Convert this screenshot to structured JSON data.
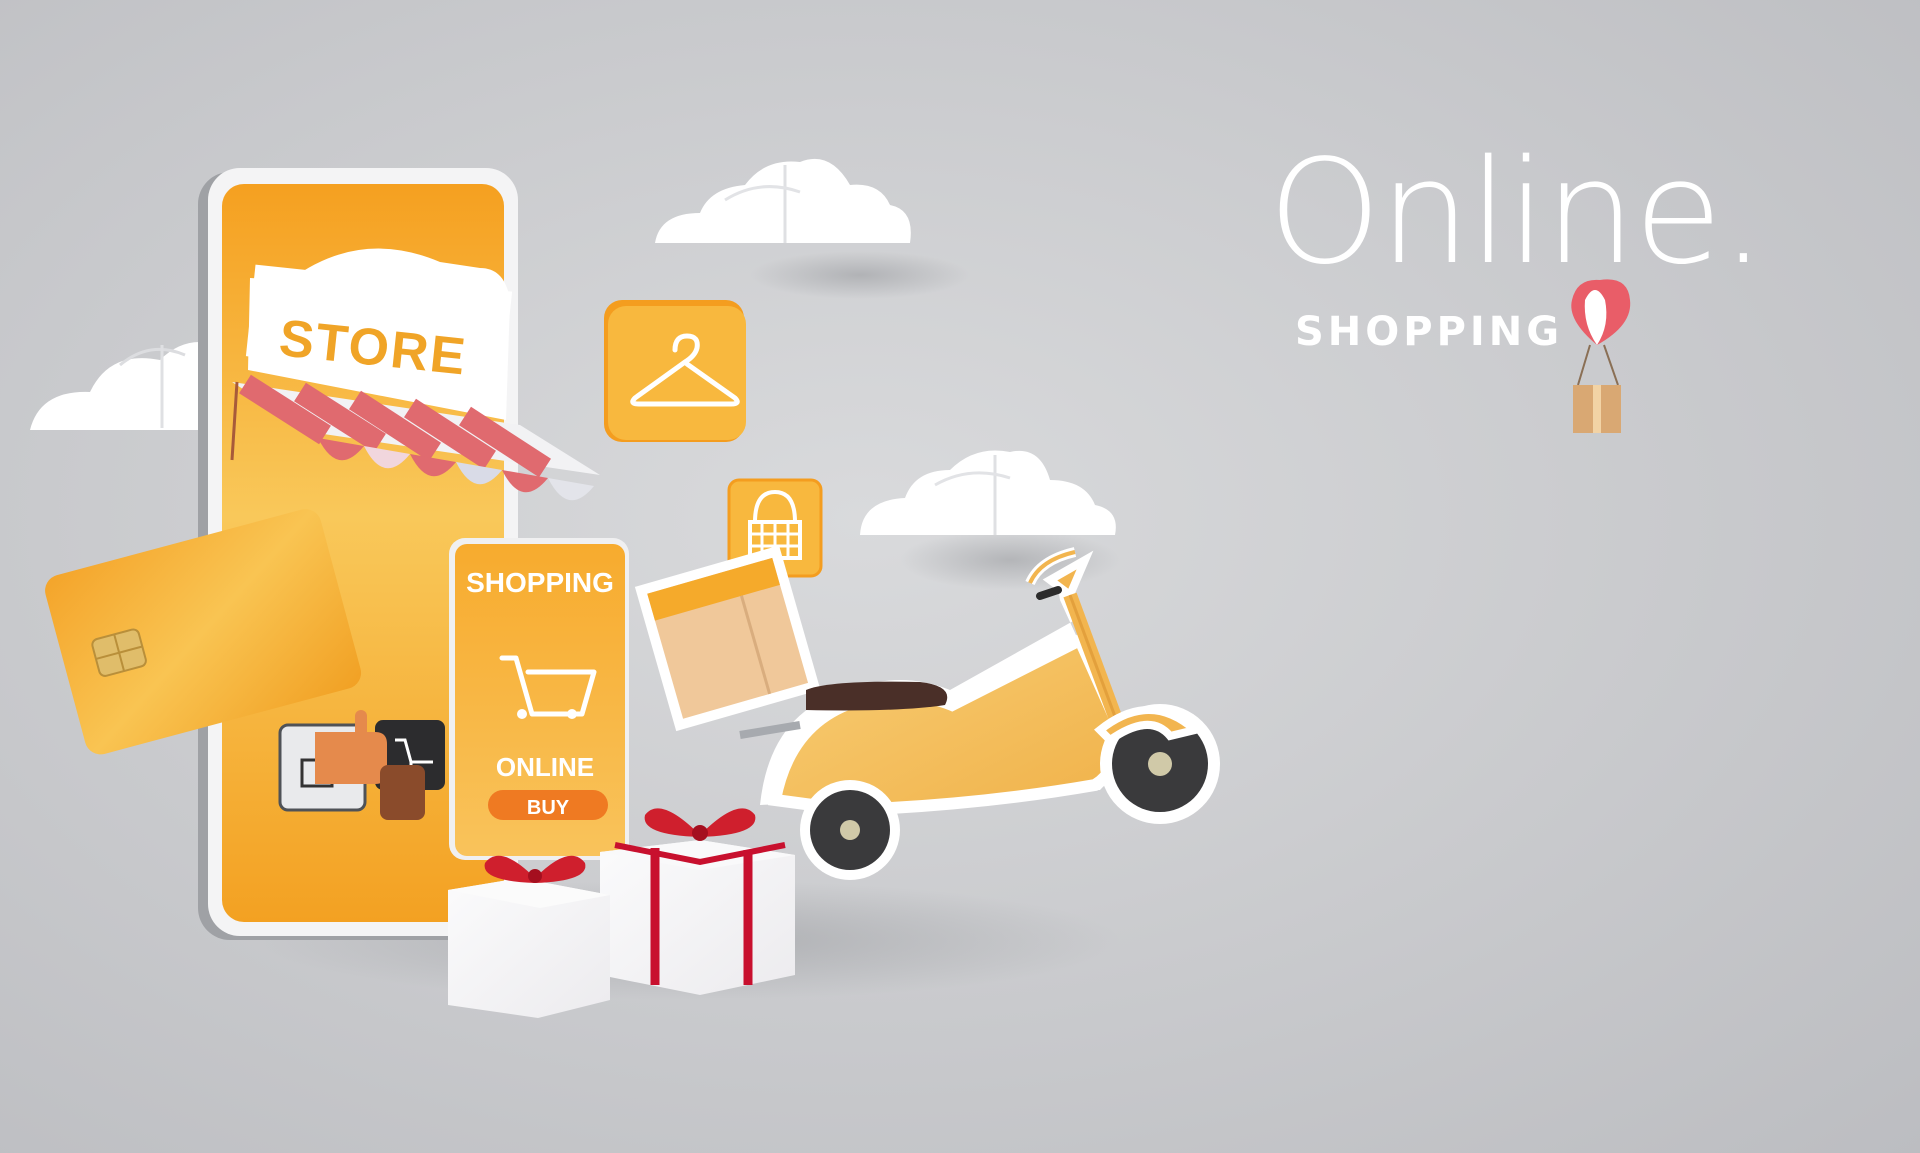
{
  "heading": {
    "title": "Online.",
    "subtitle": "SHOPPING"
  },
  "phone": {
    "sign_label": "STORE",
    "panel_title": "SHOPPING",
    "panel_online": "ONLINE",
    "buy_label": "BUY"
  },
  "colors": {
    "background": "#c9cacd",
    "accent_orange": "#f6a623",
    "awning_red": "#e06a6f",
    "buy_button": "#ef7a22",
    "ribbon_red": "#c8102e",
    "text_white": "#ffffff"
  }
}
